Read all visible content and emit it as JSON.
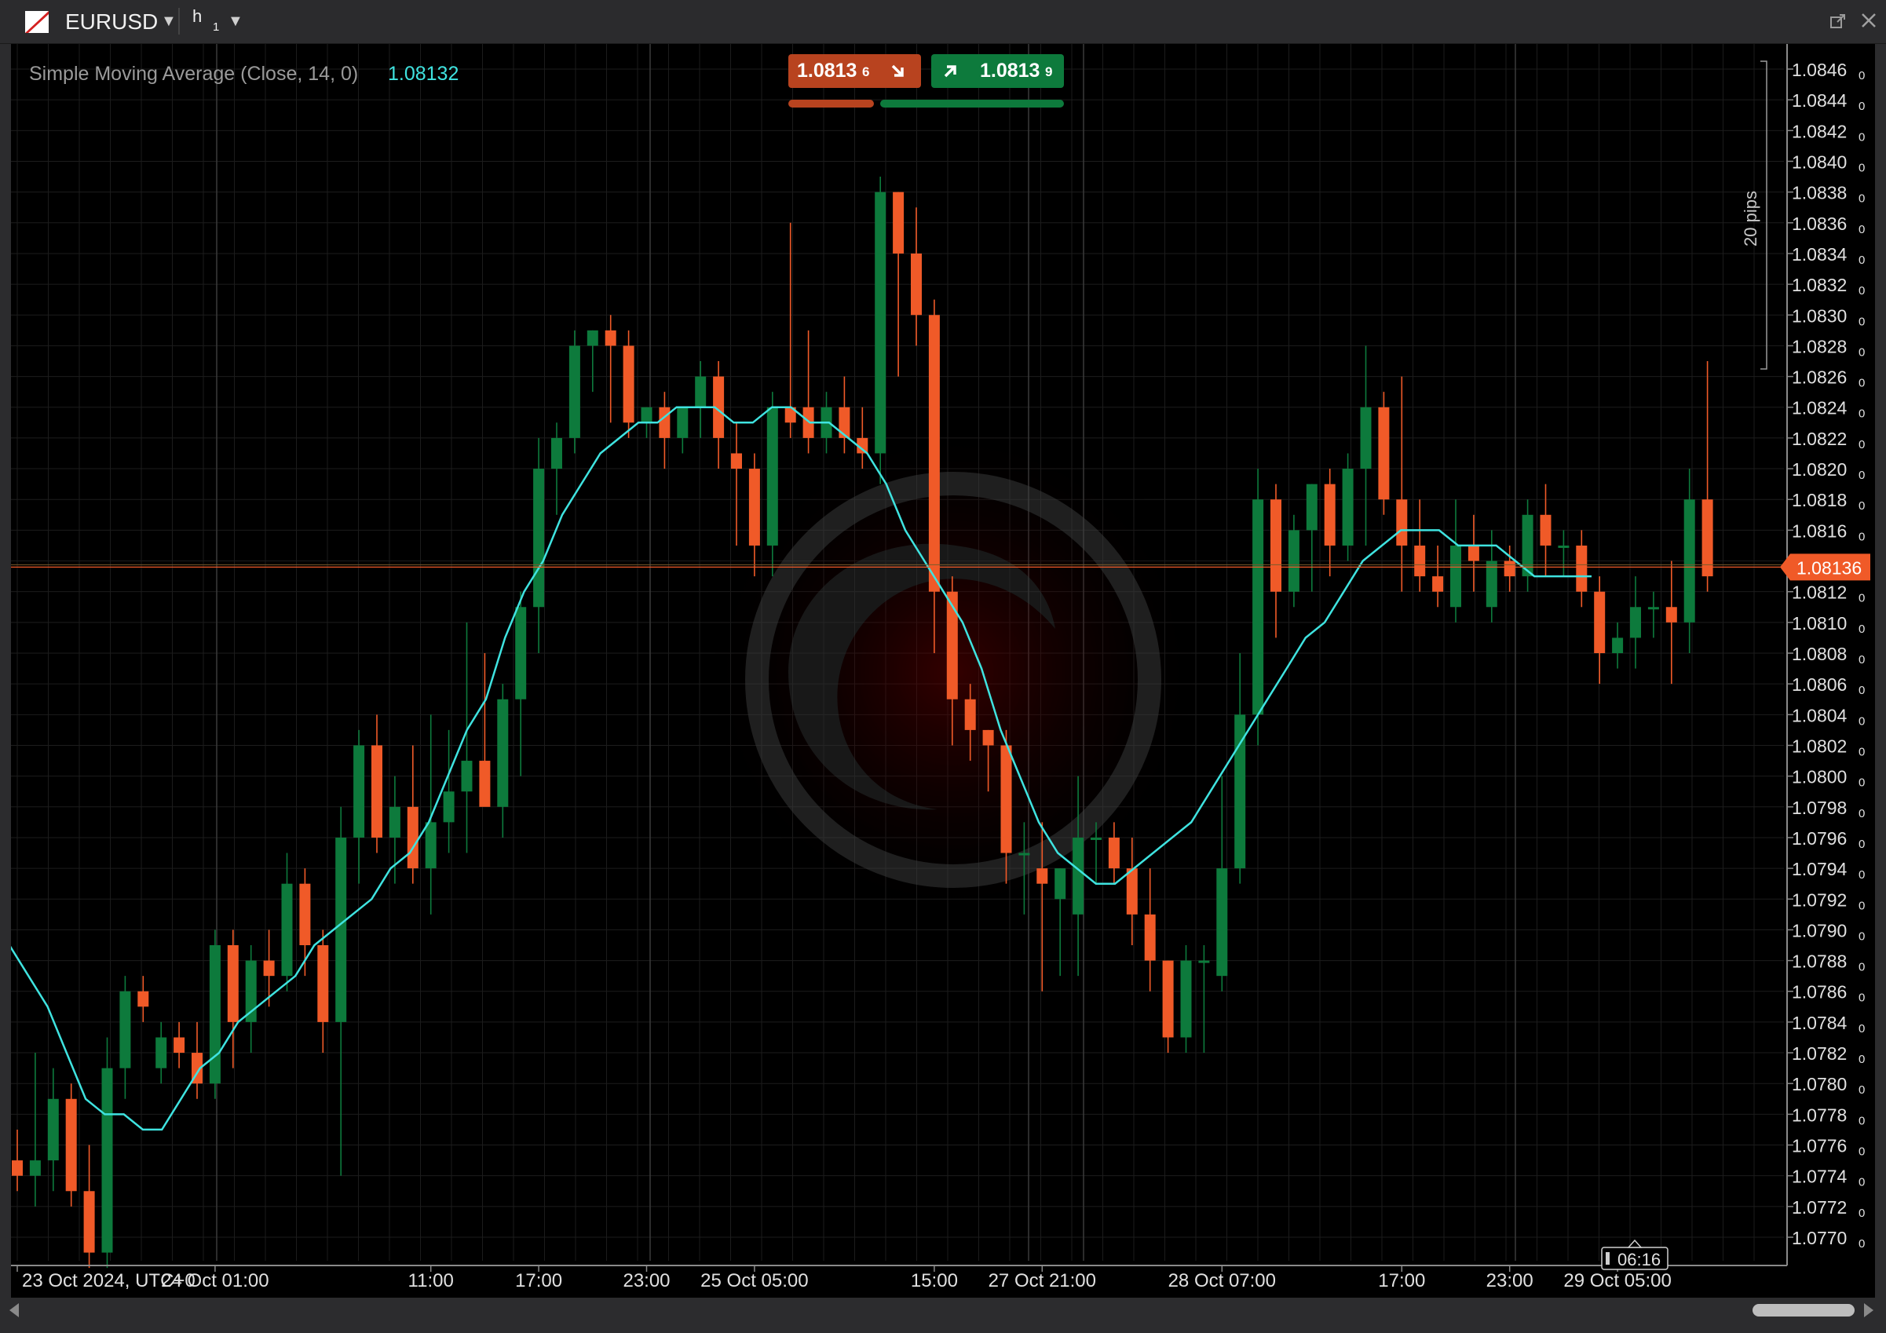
{
  "window": {
    "symbol": "EURUSD",
    "timeframe_letter": "h",
    "timeframe_number": "1"
  },
  "quote": {
    "sell_main": "1.0813",
    "sell_small": "6",
    "buy_main": "1.0813",
    "buy_small": "9"
  },
  "indicator": {
    "label": "Simple Moving Average (Close, 14, 0)",
    "value": "1.08132"
  },
  "current_price_label": "1.08136",
  "countdown": "06:16",
  "ruler_label": "20 pips",
  "colors": {
    "bull": "#0d7a3c",
    "bear": "#f05a28",
    "sma": "#3fe3e0",
    "price_line": "#f05a28",
    "background": "#000000"
  },
  "icons": [
    "symbol-flag-icon",
    "caret-down-icon",
    "detach-icon",
    "close-icon",
    "arrow-down-right-icon",
    "arrow-up-right-icon",
    "scroll-left-icon",
    "scroll-right-icon"
  ],
  "chart_data": {
    "type": "candlestick",
    "symbol": "EURUSD",
    "ylim": [
      1.0768,
      1.0847
    ],
    "y_ticks": [
      "1.0846",
      "1.0844",
      "1.0842",
      "1.0840",
      "1.0838",
      "1.0836",
      "1.0834",
      "1.0832",
      "1.0830",
      "1.0828",
      "1.0826",
      "1.0824",
      "1.0822",
      "1.0820",
      "1.0818",
      "1.0816",
      "1.0814",
      "1.0812",
      "1.0810",
      "1.0808",
      "1.0806",
      "1.0804",
      "1.0802",
      "1.0800",
      "1.0798",
      "1.0796",
      "1.0794",
      "1.0792",
      "1.0790",
      "1.0788",
      "1.0786",
      "1.0784",
      "1.0782",
      "1.0780",
      "1.0778",
      "1.0776",
      "1.0774",
      "1.0772",
      "1.0770"
    ],
    "x_labels": [
      {
        "bar": 0,
        "text": "23 Oct 2024, UTC+0"
      },
      {
        "bar": 11,
        "text": "24 Oct 01:00"
      },
      {
        "bar": 23,
        "text": "11:00"
      },
      {
        "bar": 29,
        "text": "17:00"
      },
      {
        "bar": 35,
        "text": "23:00"
      },
      {
        "bar": 41,
        "text": "25 Oct 05:00"
      },
      {
        "bar": 51,
        "text": "15:00"
      },
      {
        "bar": 57,
        "text": "27 Oct 21:00"
      },
      {
        "bar": 67,
        "text": "28 Oct 07:00"
      },
      {
        "bar": 77,
        "text": "17:00"
      },
      {
        "bar": 83,
        "text": "23:00"
      },
      {
        "bar": 89,
        "text": "29 Oct 05:00"
      }
    ],
    "candles": [
      [
        1.0775,
        1.0777,
        1.0773,
        1.0774
      ],
      [
        1.0774,
        1.0782,
        1.0772,
        1.0775
      ],
      [
        1.0775,
        1.0781,
        1.0773,
        1.0779
      ],
      [
        1.0779,
        1.078,
        1.0772,
        1.0773
      ],
      [
        1.0773,
        1.0776,
        1.0768,
        1.0769
      ],
      [
        1.0769,
        1.0783,
        1.0768,
        1.0781
      ],
      [
        1.0781,
        1.0787,
        1.0779,
        1.0786
      ],
      [
        1.0786,
        1.0787,
        1.0784,
        1.0785
      ],
      [
        1.0781,
        1.0784,
        1.078,
        1.0783
      ],
      [
        1.0783,
        1.0784,
        1.0781,
        1.0782
      ],
      [
        1.0782,
        1.0784,
        1.0779,
        1.078
      ],
      [
        1.078,
        1.079,
        1.0779,
        1.0789
      ],
      [
        1.0789,
        1.079,
        1.0781,
        1.0784
      ],
      [
        1.0784,
        1.0789,
        1.0782,
        1.0788
      ],
      [
        1.0788,
        1.079,
        1.0785,
        1.0787
      ],
      [
        1.0787,
        1.0795,
        1.0786,
        1.0793
      ],
      [
        1.0793,
        1.0794,
        1.0787,
        1.0789
      ],
      [
        1.0789,
        1.079,
        1.0782,
        1.0784
      ],
      [
        1.0784,
        1.0798,
        1.0774,
        1.0796
      ],
      [
        1.0796,
        1.0803,
        1.0793,
        1.0802
      ],
      [
        1.0802,
        1.0804,
        1.0795,
        1.0796
      ],
      [
        1.0796,
        1.08,
        1.0793,
        1.0798
      ],
      [
        1.0798,
        1.0802,
        1.0793,
        1.0794
      ],
      [
        1.0794,
        1.0804,
        1.0791,
        1.0797
      ],
      [
        1.0797,
        1.0803,
        1.0795,
        1.0799
      ],
      [
        1.0799,
        1.081,
        1.0795,
        1.0801
      ],
      [
        1.0801,
        1.0808,
        1.0799,
        1.0798
      ],
      [
        1.0798,
        1.0806,
        1.0796,
        1.0805
      ],
      [
        1.0805,
        1.0812,
        1.08,
        1.0811
      ],
      [
        1.0811,
        1.0822,
        1.0808,
        1.082
      ],
      [
        1.082,
        1.0823,
        1.0817,
        1.0822
      ],
      [
        1.0822,
        1.0829,
        1.0821,
        1.0828
      ],
      [
        1.0828,
        1.0829,
        1.0825,
        1.0829
      ],
      [
        1.0829,
        1.083,
        1.0823,
        1.0828
      ],
      [
        1.0828,
        1.0829,
        1.0822,
        1.0823
      ],
      [
        1.0823,
        1.0824,
        1.0822,
        1.0824
      ],
      [
        1.0824,
        1.0825,
        1.082,
        1.0822
      ],
      [
        1.0822,
        1.0824,
        1.0821,
        1.0824
      ],
      [
        1.0824,
        1.0827,
        1.0822,
        1.0826
      ],
      [
        1.0826,
        1.0827,
        1.082,
        1.0822
      ],
      [
        1.0821,
        1.0823,
        1.0815,
        1.082
      ],
      [
        1.082,
        1.0821,
        1.0813,
        1.0815
      ],
      [
        1.0815,
        1.0825,
        1.0813,
        1.0824
      ],
      [
        1.0824,
        1.0836,
        1.0822,
        1.0823
      ],
      [
        1.0824,
        1.0829,
        1.0821,
        1.0822
      ],
      [
        1.0822,
        1.0825,
        1.0821,
        1.0824
      ],
      [
        1.0824,
        1.0826,
        1.0821,
        1.0822
      ],
      [
        1.0822,
        1.0824,
        1.082,
        1.0821
      ],
      [
        1.0821,
        1.0839,
        1.0819,
        1.0838
      ],
      [
        1.0838,
        1.0838,
        1.0826,
        1.0834
      ],
      [
        1.0834,
        1.0837,
        1.0828,
        1.083
      ],
      [
        1.083,
        1.0831,
        1.0808,
        1.0812
      ],
      [
        1.0812,
        1.0813,
        1.0802,
        1.0805
      ],
      [
        1.0805,
        1.0806,
        1.0801,
        1.0803
      ],
      [
        1.0803,
        1.0803,
        1.0799,
        1.0802
      ],
      [
        1.0802,
        1.0803,
        1.0793,
        1.0795
      ],
      [
        1.0795,
        1.0797,
        1.0791,
        1.0795
      ],
      [
        1.0794,
        1.0797,
        1.0786,
        1.0793
      ],
      [
        1.0792,
        1.0794,
        1.0787,
        1.0794
      ],
      [
        1.0791,
        1.08,
        1.0787,
        1.0796
      ],
      [
        1.0796,
        1.0797,
        1.0793,
        1.0796
      ],
      [
        1.0796,
        1.0797,
        1.0793,
        1.0794
      ],
      [
        1.0794,
        1.0796,
        1.0789,
        1.0791
      ],
      [
        1.0791,
        1.0794,
        1.0786,
        1.0788
      ],
      [
        1.0788,
        1.0788,
        1.0782,
        1.0783
      ],
      [
        1.0783,
        1.0789,
        1.0782,
        1.0788
      ],
      [
        1.0788,
        1.0789,
        1.0782,
        1.0788
      ],
      [
        1.0787,
        1.08,
        1.0786,
        1.0794
      ],
      [
        1.0794,
        1.0808,
        1.0793,
        1.0804
      ],
      [
        1.0804,
        1.082,
        1.0802,
        1.0818
      ],
      [
        1.0818,
        1.0819,
        1.0809,
        1.0812
      ],
      [
        1.0812,
        1.0817,
        1.0811,
        1.0816
      ],
      [
        1.0816,
        1.0819,
        1.0812,
        1.0819
      ],
      [
        1.0819,
        1.082,
        1.0813,
        1.0815
      ],
      [
        1.0815,
        1.0821,
        1.0814,
        1.082
      ],
      [
        1.082,
        1.0828,
        1.0815,
        1.0824
      ],
      [
        1.0824,
        1.0825,
        1.0817,
        1.0818
      ],
      [
        1.0818,
        1.0826,
        1.0812,
        1.0815
      ],
      [
        1.0815,
        1.0818,
        1.0812,
        1.0813
      ],
      [
        1.0813,
        1.0815,
        1.0811,
        1.0812
      ],
      [
        1.0811,
        1.0818,
        1.081,
        1.0815
      ],
      [
        1.0815,
        1.0817,
        1.0812,
        1.0814
      ],
      [
        1.0811,
        1.0816,
        1.081,
        1.0814
      ],
      [
        1.0814,
        1.0815,
        1.0812,
        1.0813
      ],
      [
        1.0813,
        1.0818,
        1.0812,
        1.0817
      ],
      [
        1.0817,
        1.0819,
        1.0813,
        1.0815
      ],
      [
        1.0815,
        1.0816,
        1.0813,
        1.0815
      ],
      [
        1.0815,
        1.0816,
        1.0811,
        1.0812
      ],
      [
        1.0812,
        1.0813,
        1.0806,
        1.0808
      ],
      [
        1.0808,
        1.081,
        1.0807,
        1.0809
      ],
      [
        1.0809,
        1.0813,
        1.0807,
        1.0811
      ],
      [
        1.0811,
        1.0812,
        1.0809,
        1.0811
      ],
      [
        1.0811,
        1.0814,
        1.0806,
        1.081
      ],
      [
        1.081,
        1.082,
        1.0808,
        1.0818
      ],
      [
        1.0818,
        1.0827,
        1.0812,
        1.0813
      ]
    ],
    "sma": [
      1.0789,
      1.0787,
      1.0785,
      1.0782,
      1.0779,
      1.0778,
      1.0778,
      1.0777,
      1.0777,
      1.0779,
      1.0781,
      1.0782,
      1.0784,
      1.0785,
      1.0786,
      1.0787,
      1.0789,
      1.079,
      1.0791,
      1.0792,
      1.0794,
      1.0795,
      1.0797,
      1.08,
      1.0803,
      1.0805,
      1.0809,
      1.0812,
      1.0814,
      1.0817,
      1.0819,
      1.0821,
      1.0822,
      1.0823,
      1.0823,
      1.0824,
      1.0824,
      1.0824,
      1.0823,
      1.0823,
      1.0824,
      1.0824,
      1.0823,
      1.0823,
      1.0822,
      1.0821,
      1.0819,
      1.0816,
      1.0814,
      1.0812,
      1.081,
      1.0807,
      1.0803,
      1.08,
      1.0797,
      1.0795,
      1.0794,
      1.0793,
      1.0793,
      1.0794,
      1.0795,
      1.0796,
      1.0797,
      1.0799,
      1.0801,
      1.0803,
      1.0805,
      1.0807,
      1.0809,
      1.081,
      1.0812,
      1.0814,
      1.0815,
      1.0816,
      1.0816,
      1.0816,
      1.0815,
      1.0815,
      1.0815,
      1.0814,
      1.0813,
      1.0813,
      1.0813,
      1.0813
    ]
  }
}
